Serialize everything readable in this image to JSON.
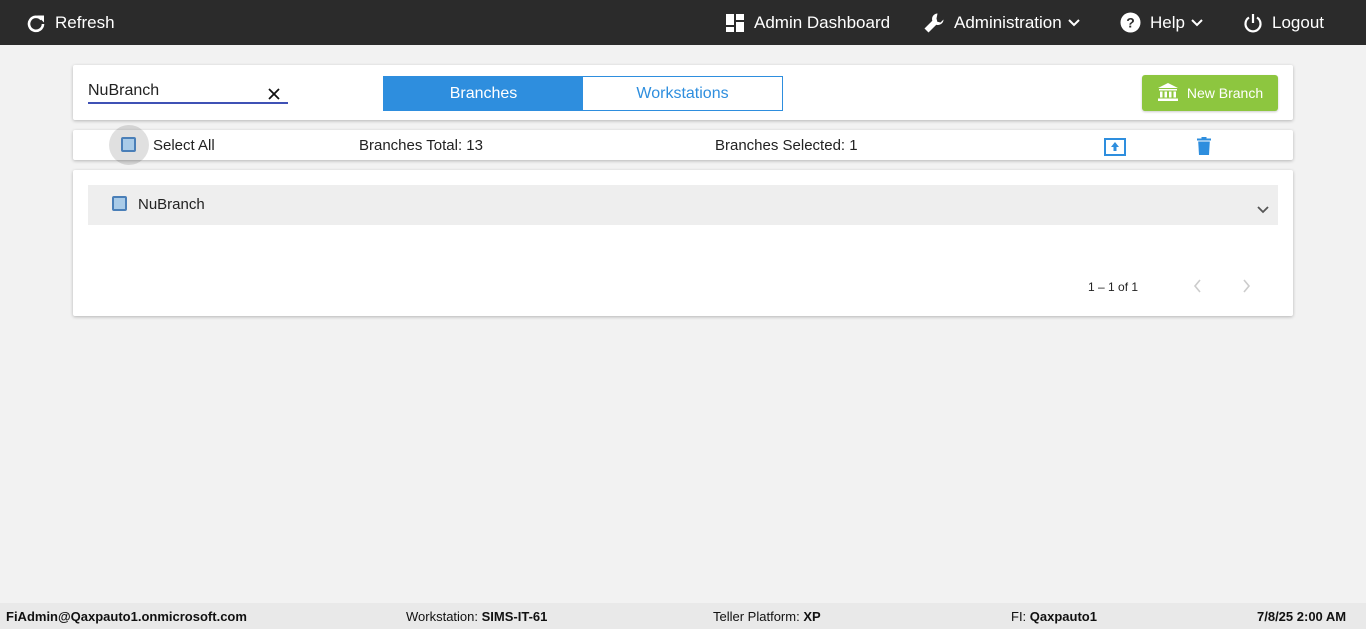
{
  "topbar": {
    "refresh_label": "Refresh",
    "admin_dashboard_label": "Admin Dashboard",
    "administration_label": "Administration",
    "help_label": "Help",
    "logout_label": "Logout"
  },
  "search": {
    "value": "NuBranch",
    "placeholder": ""
  },
  "tabs": [
    {
      "label": "Branches",
      "active": true
    },
    {
      "label": "Workstations",
      "active": false
    }
  ],
  "new_branch_label": "New Branch",
  "toolbar": {
    "select_all_label": "Select All",
    "branches_total": "Branches Total: 13",
    "branches_selected": "Branches Selected: 1"
  },
  "rows": [
    {
      "label": "NuBranch"
    }
  ],
  "pager": {
    "range": "1 – 1 of 1"
  },
  "footer": {
    "user": "FiAdmin@Qaxpauto1.onmicrosoft.com",
    "workstation_label": "Workstation:",
    "workstation_value": "SIMS-IT-61",
    "platform_label": "Teller Platform:",
    "platform_value": "XP",
    "fi_label": "FI:",
    "fi_value": "Qaxpauto1",
    "datetime": "7/8/25 2:00 AM"
  },
  "colors": {
    "topbar_bg": "#2b2b2b",
    "accent_blue": "#2e8ede",
    "new_branch_green": "#8dc63f",
    "page_bg": "#f2f2f2"
  }
}
